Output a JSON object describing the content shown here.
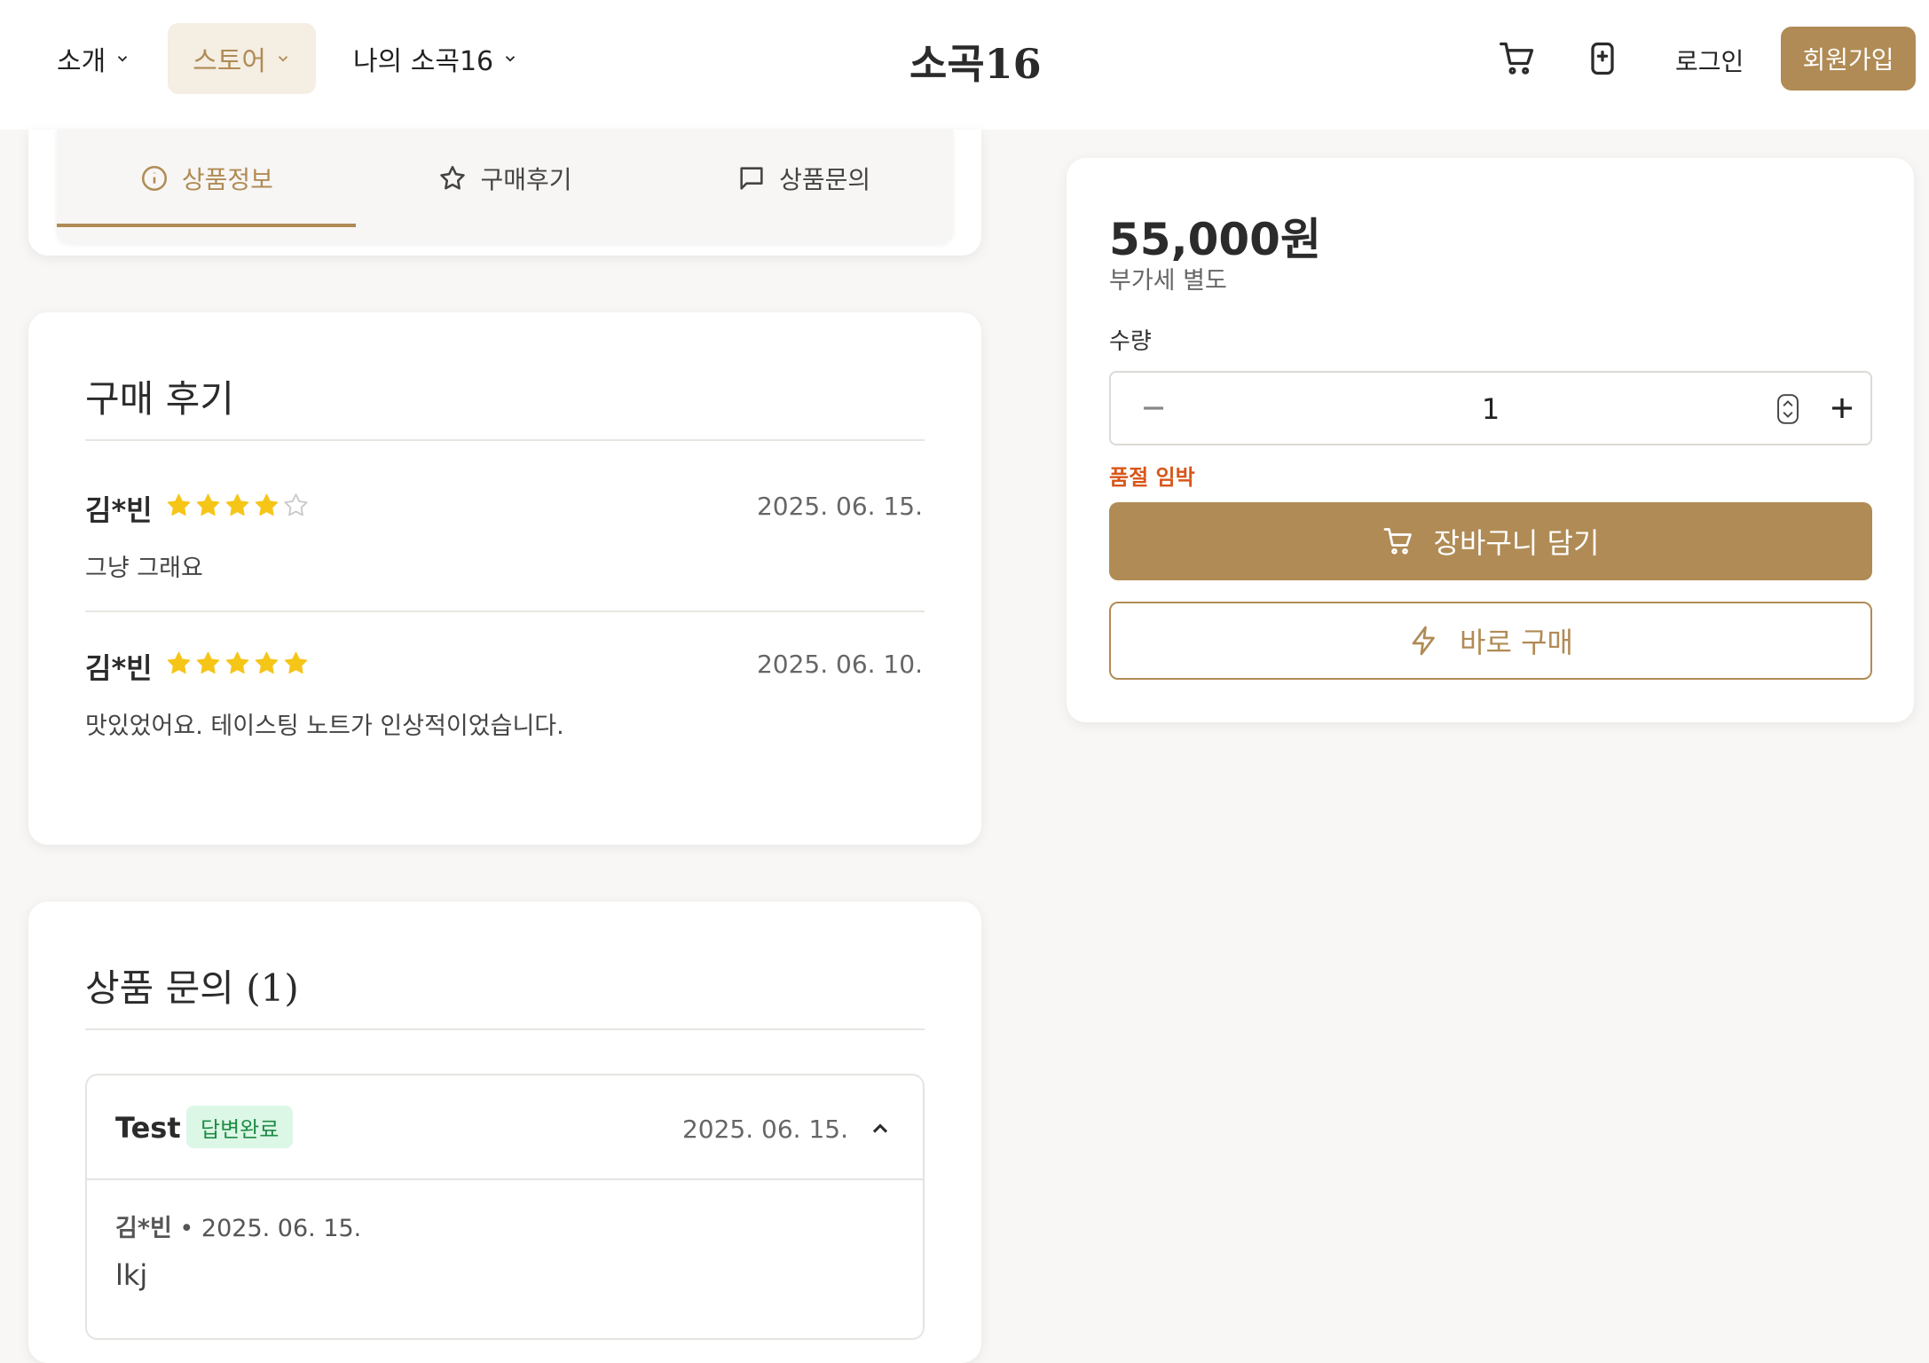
{
  "header": {
    "nav": [
      {
        "label": "소개"
      },
      {
        "label": "스토어"
      },
      {
        "label": "나의 소곡16"
      }
    ],
    "brand": "소곡16",
    "login": "로그인",
    "signup": "회원가입"
  },
  "tabs": [
    {
      "label": "상품정보",
      "icon": "info-icon"
    },
    {
      "label": "구매후기",
      "icon": "star-outline-icon"
    },
    {
      "label": "상품문의",
      "icon": "chat-bubble-icon"
    }
  ],
  "reviews": {
    "title": "구매 후기",
    "items": [
      {
        "name": "김*빈",
        "rating": 4,
        "date": "2025. 06. 15.",
        "text": "그냥 그래요"
      },
      {
        "name": "김*빈",
        "rating": 5,
        "date": "2025. 06. 10.",
        "text": "맛있었어요. 테이스팅 노트가 인상적이었습니다."
      }
    ]
  },
  "inquiries": {
    "title": "상품 문의 (1)",
    "items": [
      {
        "title": "Test",
        "badge": "답변완료",
        "date": "2025. 06. 15.",
        "author": "김*빈",
        "meta_date": "2025. 06. 15.",
        "body": "lkj"
      }
    ]
  },
  "purchase": {
    "price": "55,000원",
    "vat": "부가세 별도",
    "qty_label": "수량",
    "qty_value": "1",
    "stock_notice": "품절 임박",
    "cart_button": "장바구니 담기",
    "buy_button": "바로 구매"
  },
  "colors": {
    "accent": "#b08b55",
    "star": "#f5c518",
    "badge_bg": "#dcf7e6",
    "badge_text": "#1e8b45",
    "warning": "#d8561a"
  }
}
